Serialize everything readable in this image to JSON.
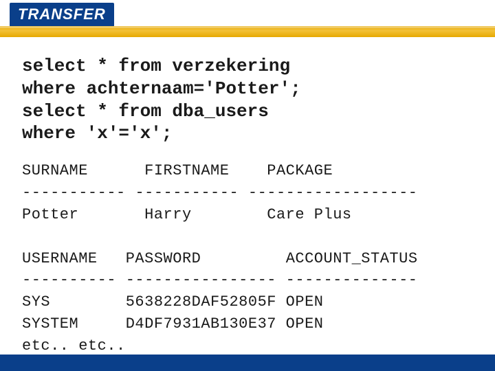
{
  "brand": "TRANSFER",
  "sql": {
    "line1": "select * from verzekering",
    "line2": "where achternaam='Potter';",
    "line3": "select * from dba_users",
    "line4": "where 'x'='x';"
  },
  "result1": {
    "headers": [
      "SURNAME",
      "FIRSTNAME",
      "PACKAGE"
    ],
    "sep": [
      "-----------",
      "-----------",
      "------------------"
    ],
    "rows": [
      {
        "surname": "Potter",
        "firstname": "Harry",
        "package": "Care Plus"
      }
    ]
  },
  "result2": {
    "headers": [
      "USERNAME",
      "PASSWORD",
      "ACCOUNT_STATUS"
    ],
    "sep": [
      "----------",
      "----------------",
      "--------------"
    ],
    "rows": [
      {
        "username": "SYS",
        "password": "5638228DAF52805F",
        "account_status": "OPEN"
      },
      {
        "username": "SYSTEM",
        "password": "D4DF7931AB130E37",
        "account_status": "OPEN"
      }
    ],
    "trailer": "etc.. etc.."
  },
  "chart_data": {
    "type": "table",
    "tables": [
      {
        "columns": [
          "SURNAME",
          "FIRSTNAME",
          "PACKAGE"
        ],
        "rows": [
          [
            "Potter",
            "Harry",
            "Care Plus"
          ]
        ]
      },
      {
        "columns": [
          "USERNAME",
          "PASSWORD",
          "ACCOUNT_STATUS"
        ],
        "rows": [
          [
            "SYS",
            "5638228DAF52805F",
            "OPEN"
          ],
          [
            "SYSTEM",
            "D4DF7931AB130E37",
            "OPEN"
          ]
        ]
      }
    ]
  }
}
